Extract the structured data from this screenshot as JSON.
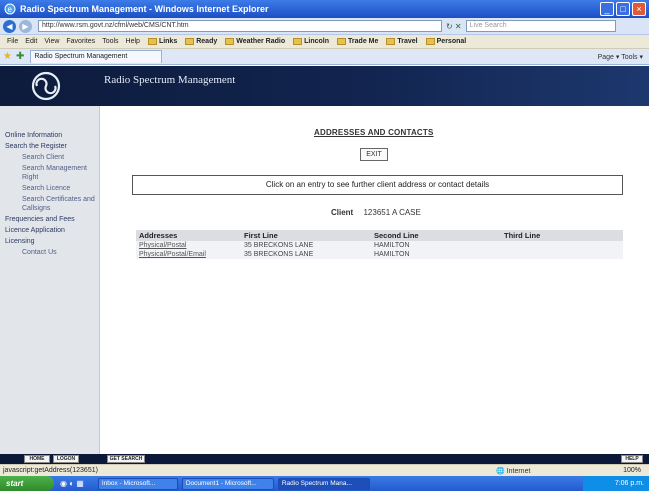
{
  "window": {
    "title": "Radio Spectrum Management - Windows Internet Explorer"
  },
  "address_bar": {
    "url": "http://www.rsm.govt.nz/cfml/web/CMS/CNT.htm",
    "search_placeholder": "Live Search"
  },
  "menu": [
    "File",
    "Edit",
    "View",
    "Favorites",
    "Tools",
    "Help"
  ],
  "favorites": [
    "Links",
    "Ready",
    "Weather Radio",
    "Lincoln",
    "Trade Me",
    "Travel",
    "Personal"
  ],
  "tab": {
    "label": "Radio Spectrum Management"
  },
  "command_bar": "Page ▾ Tools ▾",
  "site": {
    "title": "Radio Spectrum Management"
  },
  "sidebar": {
    "items": [
      {
        "label": "Online Information",
        "sub": false
      },
      {
        "label": "Search the Register",
        "sub": false
      },
      {
        "label": "Search Client",
        "sub": true
      },
      {
        "label": "Search Management Right",
        "sub": true
      },
      {
        "label": "Search Licence",
        "sub": true
      },
      {
        "label": "Search Certificates and Callsigns",
        "sub": true
      },
      {
        "label": "Frequencies and Fees",
        "sub": false
      },
      {
        "label": "Licence Application",
        "sub": false
      },
      {
        "label": "Licensing",
        "sub": false
      },
      {
        "label": "Contact Us",
        "sub": true
      }
    ]
  },
  "main": {
    "heading": "ADDRESSES AND CONTACTS",
    "exit_label": "EXIT",
    "info_text": "Click on an entry to see further client address or contact details",
    "client_label": "Client",
    "client_value": "123651  A  CASE",
    "table": {
      "headers": [
        "Addresses",
        "First Line",
        "Second Line",
        "Third Line"
      ],
      "rows": [
        [
          "Physical/Postal",
          "35 BRECKONS LANE",
          "HAMILTON",
          ""
        ],
        [
          "Physical/Postal/Email",
          "35 BRECKONS LANE",
          "HAMILTON",
          ""
        ]
      ]
    }
  },
  "bottom_buttons": {
    "home": "HOME",
    "logon": "LOGON",
    "get_search": "GET SEARCH",
    "help": "HELP"
  },
  "status": {
    "text": "javascript:getAddress(123651)",
    "zone": "Internet",
    "zoom": "100%"
  },
  "taskbar": {
    "start": "start",
    "tasks": [
      "Inbox - Microsoft...",
      "Document1 - Microsoft...",
      "Radio Spectrum Mana..."
    ],
    "clock": "7:06 p.m."
  }
}
